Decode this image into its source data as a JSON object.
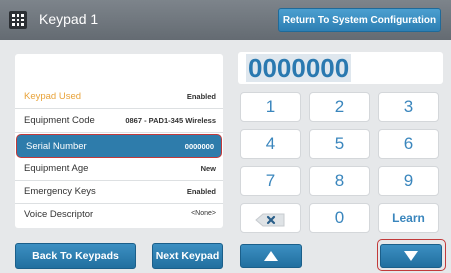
{
  "header": {
    "title": "Keypad 1",
    "return_label": "Return To System Configuration",
    "menu_icon": "grid-icon"
  },
  "details": [
    {
      "label": "Keypad Used",
      "value": "Enabled",
      "highlight": "orange"
    },
    {
      "label": "Equipment Code",
      "value": "0867 - PAD1-345 Wireless"
    },
    {
      "label": "Serial Number",
      "value": "0000000",
      "selected": true
    },
    {
      "label": "Equipment Age",
      "value": "New"
    },
    {
      "label": "Emergency Keys",
      "value": "Enabled"
    },
    {
      "label": "Voice Descriptor",
      "value": "<None>"
    }
  ],
  "buttons": {
    "back": "Back To Keypads",
    "next": "Next Keypad"
  },
  "keypad": {
    "display": "0000000",
    "keys": [
      "1",
      "2",
      "3",
      "4",
      "5",
      "6",
      "7",
      "8",
      "9",
      "",
      "0",
      "Learn"
    ],
    "backspace_icon": "backspace-icon",
    "up_icon": "arrow-up-icon",
    "down_icon": "arrow-down-icon"
  },
  "colors": {
    "accent": "#2e7cab",
    "highlight": "#e8a33a",
    "selection_border": "#c23a3a"
  }
}
